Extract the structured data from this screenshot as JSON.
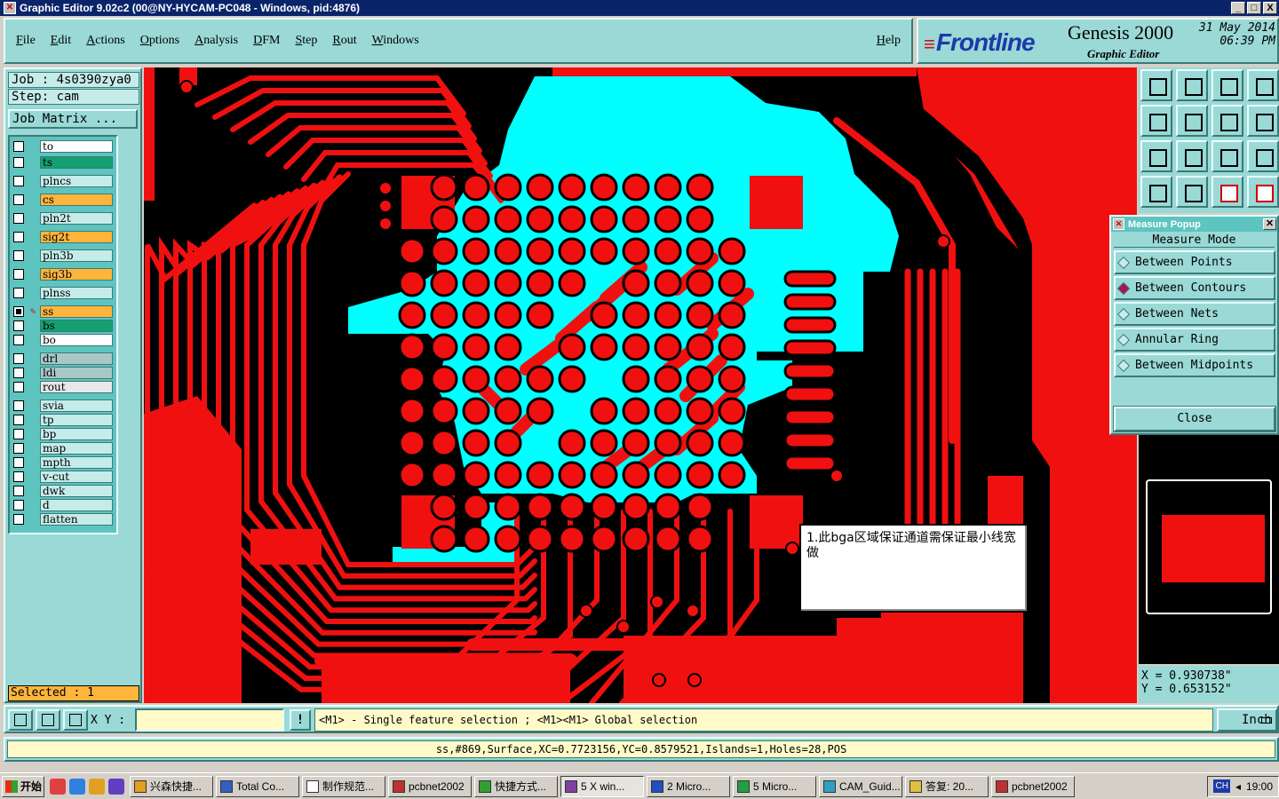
{
  "window": {
    "title": "Graphic Editor 9.02c2  (00@NY-HYCAM-PC048 - Windows, pid:4876)",
    "min": "_",
    "max": "□",
    "close": "X"
  },
  "menu": [
    "File",
    "Edit",
    "Actions",
    "Options",
    "Analysis",
    "DFM",
    "Step",
    "Rout",
    "Windows"
  ],
  "help": "Help",
  "brand": {
    "logo": "Frontline",
    "product": "Genesis 2000",
    "subtitle": "Graphic Editor",
    "date": "31 May 2014",
    "time": "06:39 PM"
  },
  "job": {
    "job_line": "Job : 4s0390zya0",
    "step_line": "Step: cam",
    "matrix_button": "Job Matrix ..."
  },
  "layers": [
    {
      "name": "to",
      "color": "#ffffff",
      "mark": "✎",
      "checked": false
    },
    {
      "name": "ts",
      "color": "#14a070",
      "mark": "✎",
      "checked": false
    },
    {
      "name": "plncs",
      "color": "#c6ecea",
      "mark": "",
      "checked": false
    },
    {
      "name": "cs",
      "color": "#ffb53c",
      "mark": "✎",
      "checked": false
    },
    {
      "name": "pln2t",
      "color": "#c6ecea",
      "mark": "",
      "checked": false
    },
    {
      "name": "sig2t",
      "color": "#ffb53c",
      "mark": "✎",
      "checked": false
    },
    {
      "name": "pln3b",
      "color": "#c6ecea",
      "mark": "",
      "checked": false
    },
    {
      "name": "sig3b",
      "color": "#ffb53c",
      "mark": "✎",
      "checked": false
    },
    {
      "name": "plnss",
      "color": "#c6ecea",
      "mark": "",
      "checked": false
    },
    {
      "name": "ss",
      "color": "#ffb53c",
      "mark": "✎ ⊞",
      "checked": true
    },
    {
      "name": "bs",
      "color": "#14a070",
      "mark": "✎",
      "checked": false
    },
    {
      "name": "bo",
      "color": "#ffffff",
      "mark": "✎",
      "checked": false
    },
    {
      "name": "drl",
      "color": "#a8c8c8",
      "mark": "",
      "checked": false
    },
    {
      "name": "ldi",
      "color": "#a8c8c8",
      "mark": "",
      "checked": false
    },
    {
      "name": "rout",
      "color": "#e8e8e8",
      "mark": "",
      "checked": false
    },
    {
      "name": "svia",
      "color": "#c6ecea",
      "mark": "",
      "checked": false
    },
    {
      "name": "tp",
      "color": "#c6ecea",
      "mark": "",
      "checked": false
    },
    {
      "name": "bp",
      "color": "#c6ecea",
      "mark": "",
      "checked": false
    },
    {
      "name": "map",
      "color": "#c6ecea",
      "mark": "✎",
      "checked": false
    },
    {
      "name": "mpth",
      "color": "#c6ecea",
      "mark": "",
      "checked": false
    },
    {
      "name": "v-cut",
      "color": "#c6ecea",
      "mark": "",
      "checked": false
    },
    {
      "name": "dwk",
      "color": "#c6ecea",
      "mark": "",
      "checked": false
    },
    {
      "name": "d",
      "color": "#c6ecea",
      "mark": "",
      "checked": false
    },
    {
      "name": "flatten",
      "color": "#c6ecea",
      "mark": "",
      "checked": false
    }
  ],
  "selected": "Selected : 1",
  "note": "1.此bga区域保证通道需保证最小线宽做",
  "measure": {
    "title": "Measure Popup",
    "mode_label": "Measure Mode",
    "options": [
      "Between Points",
      "Between Contours",
      "Between Nets",
      "Annular Ring",
      "Between Midpoints"
    ],
    "selected_index": 1,
    "close": "Close"
  },
  "coords": {
    "x": "X = 0.930738\"",
    "y": "Y = 0.653152\""
  },
  "bottom": {
    "xy_label": "X Y :",
    "xy_value": "",
    "excl": "!",
    "hint": "<M1> - Single feature selection ; <M1><M1> Global selection",
    "units": "Inch"
  },
  "status": "ss,#869,Surface,XC=0.7723156,YC=0.8579521,Islands=1,Holes=28,POS",
  "taskbar": {
    "start": "开始",
    "tasks": [
      {
        "label": "兴森快捷...",
        "active": false,
        "color": "#e0a020"
      },
      {
        "label": "Total Co...",
        "active": false,
        "color": "#3060c0"
      },
      {
        "label": "制作规范...",
        "active": false,
        "color": "#ffffff"
      },
      {
        "label": "pcbnet2002",
        "active": false,
        "color": "#c03030"
      },
      {
        "label": "快捷方式...",
        "active": false,
        "color": "#30a030"
      },
      {
        "label": "5 X win...",
        "active": true,
        "color": "#8040a0"
      },
      {
        "label": "2 Micro...",
        "active": false,
        "color": "#2050c0"
      },
      {
        "label": "5 Micro...",
        "active": false,
        "color": "#20a040"
      },
      {
        "label": "CAM_Guid...",
        "active": false,
        "color": "#30a0c0"
      },
      {
        "label": "答复: 20...",
        "active": false,
        "color": "#e0c040"
      },
      {
        "label": "pcbnet2002",
        "active": false,
        "color": "#c03030"
      }
    ],
    "lang": "CH",
    "clock": "19:00"
  },
  "colors": {
    "copper": "#f01010",
    "cyan": "#00ffff",
    "background": "#000000",
    "panel": "#9ad9d6"
  }
}
